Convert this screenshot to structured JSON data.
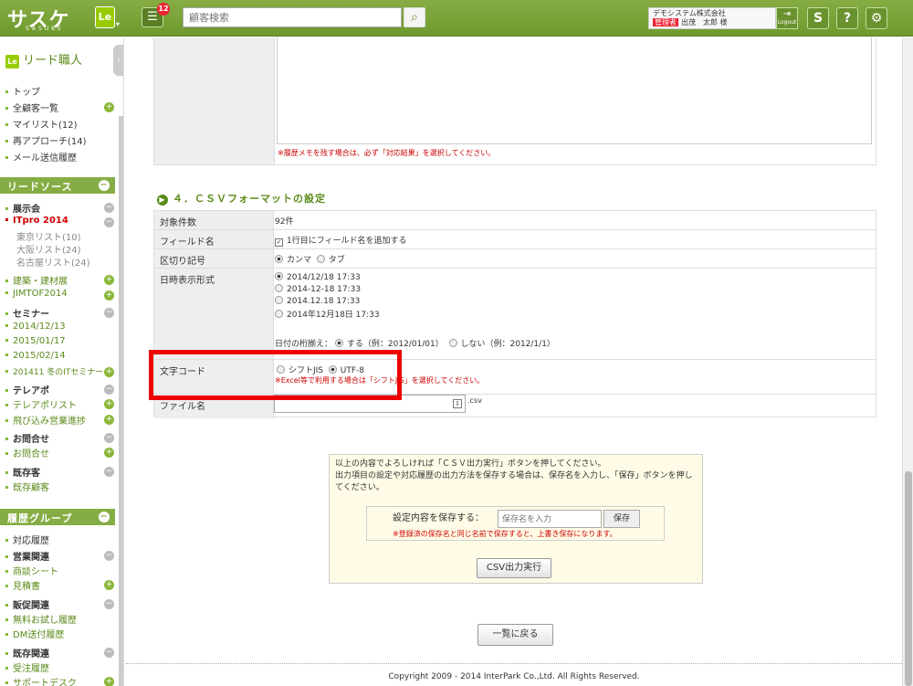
{
  "header": {
    "logo": "サスケ",
    "logo_sub": "SASUKE",
    "app_badge": "Le",
    "notice_count": "12",
    "search_placeholder": "顧客検索",
    "company": "デモシステム株式会社",
    "role": "管理者",
    "user_name": "出茂　太郎 様",
    "logout": "Logout",
    "colors": {
      "bar": "#86ad45",
      "alert": "#e22233"
    }
  },
  "sidebar": {
    "title": "リード職人",
    "top_items": [
      "トップ",
      "全顧客一覧",
      "マイリスト(12)",
      "再アプローチ(14)",
      "メール送信履歴"
    ],
    "lead_header": "リードソース",
    "lead_groups": [
      {
        "label": "展示会",
        "items": [
          "ITpro 2014"
        ],
        "subs": [
          "東京リスト(10)",
          "大阪リスト(24)",
          "名古屋リスト(24)"
        ],
        "more": [
          "建築・建材展",
          "JIMTOF2014"
        ]
      },
      {
        "label": "セミナー",
        "items": [
          "2014/12/13",
          "2015/01/17",
          "2015/02/14",
          "201411 冬のITセミナー"
        ]
      },
      {
        "label": "テレアポ",
        "items": [
          "テレアポリスト",
          "飛び込み営業進捗"
        ]
      },
      {
        "label": "お問合せ",
        "items": [
          "お問合せ"
        ]
      },
      {
        "label": "既存客",
        "items": [
          "既存顧客"
        ]
      }
    ],
    "history_header": "履歴グループ",
    "history_groups": [
      {
        "label": "対応履歴"
      },
      {
        "label": "営業関連",
        "items": [
          "商談シート",
          "見積書"
        ]
      },
      {
        "label": "販促関連",
        "items": [
          "無料お試し履歴",
          "DM送付履歴"
        ]
      },
      {
        "label": "既存関連",
        "items": [
          "受注履歴",
          "サポートデスク"
        ]
      }
    ]
  },
  "memo_note": "※履歴メモを残す場合は、必ず「対応結果」を選択してください。",
  "section_title": "４．ＣＳＶフォーマットの設定",
  "csv": {
    "count_label": "対象件数",
    "count_value": "92件",
    "field_label": "フィールド名",
    "field_option": "1行目にフィールド名を追加する",
    "delim_label": "区切り記号",
    "delim_options": [
      "カンマ",
      "タブ"
    ],
    "date_label": "日時表示形式",
    "date_options": [
      "2014/12/18 17:33",
      "2014-12-18 17:33",
      "2014.12.18 17:33",
      "2014年12月18日 17:33"
    ],
    "pad_label": "日付の桁揃え：",
    "pad_options": [
      "する（例：2012/01/01）",
      "しない（例：2012/1/1）"
    ],
    "enc_label": "文字コード",
    "enc_options": [
      "シフトJIS",
      "UTF-8"
    ],
    "enc_note": "※Excel等で利用する場合は「シフトJIS」を選択してください。",
    "fname_label": "ファイル名",
    "fname_ext": ".csv"
  },
  "panel": {
    "line1": "以上の内容でよろしければ「ＣＳＶ出力実行」ボタンを押してください。",
    "line2": "出力項目の設定や対応履歴の出力方法を保存する場合は、保存名を入力し、「保存」ボタンを押してください。",
    "save_label": "設定内容を保存する：",
    "save_placeholder": "保存名を入力",
    "save_button": "保存",
    "save_note": "※登録済の保存名と同じ名前で保存すると、上書き保存になります。",
    "csv_button": "CSV出力実行"
  },
  "back_button": "一覧に戻る",
  "footer": "Copyright 2009 - 2014 InterPark Co.,Ltd. All Rights Reserved."
}
